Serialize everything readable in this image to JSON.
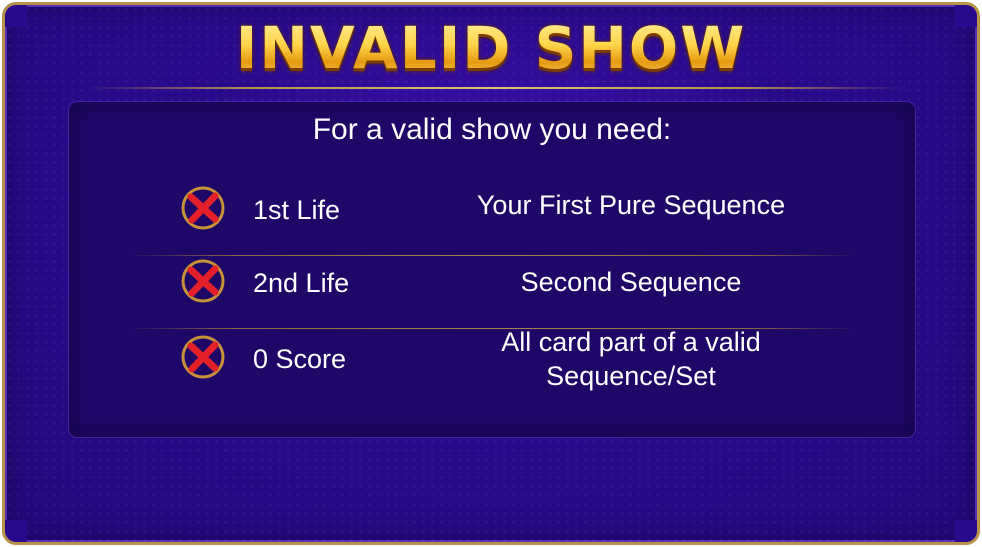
{
  "dialog": {
    "title": "INVALID SHOW",
    "subtitle": "For a valid show you need:",
    "requirements": [
      {
        "label": "1st Life",
        "description": "Your First Pure Sequence",
        "status_icon": "cross-icon",
        "met": false
      },
      {
        "label": "2nd Life",
        "description": "Second Sequence",
        "status_icon": "cross-icon",
        "met": false
      },
      {
        "label": "0 Score",
        "description": "All card part of a valid Sequence/Set",
        "status_icon": "cross-icon",
        "met": false
      }
    ]
  },
  "colors": {
    "background": "#2a0a8c",
    "panel": "#1e0766",
    "border_gold": "#b8914a",
    "title_gold": "#f7c948",
    "cross_red": "#e3202a",
    "text": "#ffffff"
  }
}
